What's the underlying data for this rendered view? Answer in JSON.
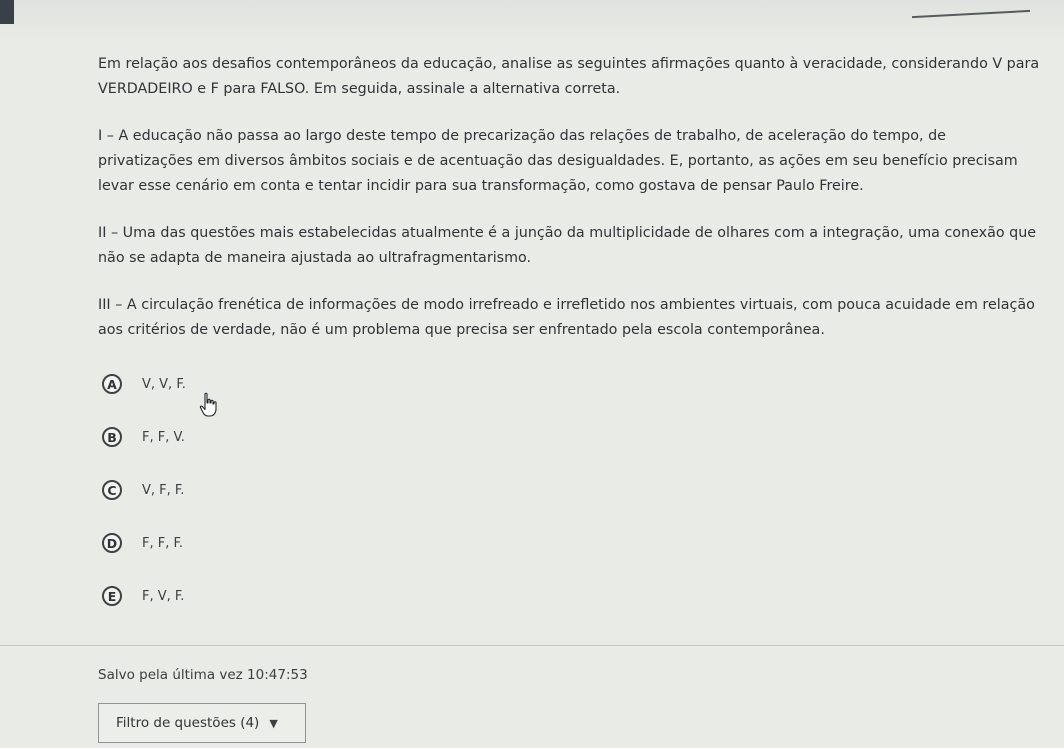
{
  "question": {
    "prompt": "Em relação aos desafios contemporâneos da educação, analise as seguintes afirmações quanto à veracidade, considerando V para VERDADEIRO e F para FALSO. Em seguida, assinale a alternativa correta.",
    "statements": [
      "I – A educação não passa ao largo deste tempo de precarização das relações de trabalho, de aceleração do tempo, de privatizações em diversos âmbitos sociais e de acentuação das desigualdades. E, portanto, as ações em seu benefício precisam levar esse cenário em conta e tentar incidir para sua transformação, como gostava de pensar Paulo Freire.",
      "II – Uma das questões mais estabelecidas atualmente é a junção da multiplicidade de olhares com a integração, uma conexão que não se adapta de maneira ajustada ao ultrafragmentarismo.",
      "III – A circulação frenética de informações de modo irrefreado e irrefletido nos ambientes virtuais, com pouca acuidade em relação aos critérios de verdade, não é um problema que precisa ser enfrentado pela escola contemporânea."
    ]
  },
  "options": [
    {
      "letter": "A",
      "text": "V, V, F."
    },
    {
      "letter": "B",
      "text": "F, F, V."
    },
    {
      "letter": "C",
      "text": "V, F, F."
    },
    {
      "letter": "D",
      "text": "F, F, F."
    },
    {
      "letter": "E",
      "text": "F, V, F."
    }
  ],
  "footer": {
    "saved_label": "Salvo pela última vez 10:47:53",
    "filter_label": "Filtro de questões (4)",
    "filter_caret": "▼"
  },
  "icons": {
    "cursor": "hand-pointer-icon"
  }
}
